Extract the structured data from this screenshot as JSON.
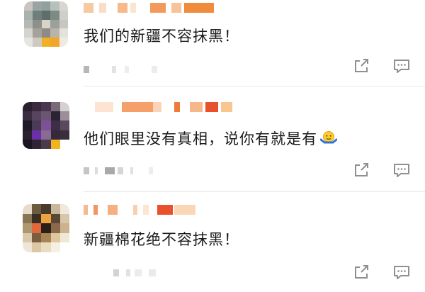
{
  "comments": [
    {
      "text": "我们的新疆不容抹黑！",
      "avatar_icon": "pixelated-avatar",
      "username_state": "redacted",
      "meta_state": "redacted"
    },
    {
      "text": "他们眼里没有真相，说你有就是有",
      "emoji": "shrug-emoji",
      "avatar_icon": "pixelated-avatar",
      "username_state": "redacted",
      "meta_state": "redacted"
    },
    {
      "text": "新疆棉花绝不容抹黑！",
      "avatar_icon": "pixelated-avatar",
      "username_state": "redacted",
      "meta_state": "redacted"
    }
  ],
  "actions": {
    "share_icon": "share-icon",
    "reply_icon": "comment-icon"
  },
  "colors": {
    "text": "#1b1b1b",
    "icon": "#8f8f8f",
    "divider": "#e6e6e6",
    "redaction_orange": "#f7a35c",
    "redaction_red": "#e8502e"
  }
}
